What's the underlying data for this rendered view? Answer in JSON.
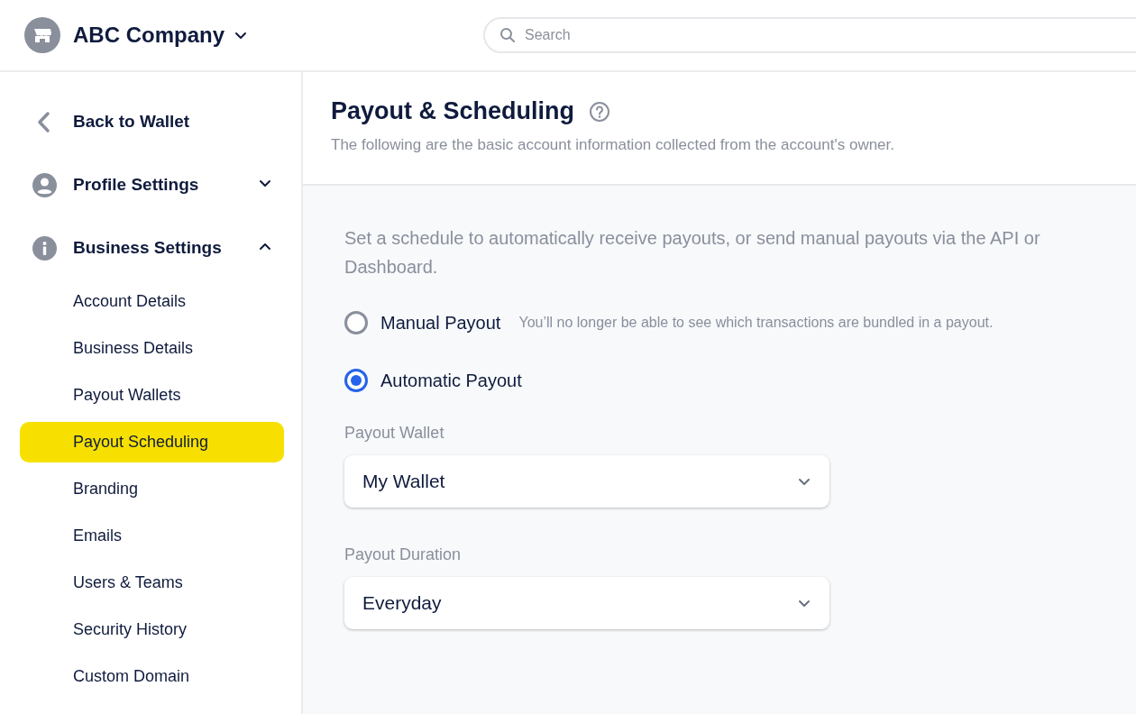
{
  "header": {
    "company": "ABC Company",
    "search": {
      "placeholder": "Search"
    }
  },
  "sidebar": {
    "back": "Back to Wallet",
    "sections": [
      {
        "label": "Profile Settings",
        "expanded": false
      },
      {
        "label": "Business Settings",
        "expanded": true,
        "items": [
          {
            "label": "Account Details",
            "selected": false
          },
          {
            "label": "Business Details",
            "selected": false
          },
          {
            "label": "Payout Wallets",
            "selected": false
          },
          {
            "label": "Payout Scheduling",
            "selected": true
          },
          {
            "label": "Branding",
            "selected": false
          },
          {
            "label": "Emails",
            "selected": false
          },
          {
            "label": "Users & Teams",
            "selected": false
          },
          {
            "label": "Security History",
            "selected": false
          },
          {
            "label": "Custom Domain",
            "selected": false
          }
        ]
      }
    ]
  },
  "page": {
    "title": "Payout & Scheduling",
    "subtitle": "The following are the basic account information collected from the account's owner.",
    "intro": "Set a schedule to automatically receive payouts, or send manual payouts via the API or Dashboard.",
    "options": [
      {
        "label": "Manual Payout",
        "note": "You’ll no longer be able to see which transactions are bundled in a payout.",
        "selected": false
      },
      {
        "label": "Automatic Payout",
        "selected": true
      }
    ],
    "fields": [
      {
        "label": "Payout Wallet",
        "value": "My Wallet"
      },
      {
        "label": "Payout Duration",
        "value": "Everyday"
      }
    ]
  }
}
